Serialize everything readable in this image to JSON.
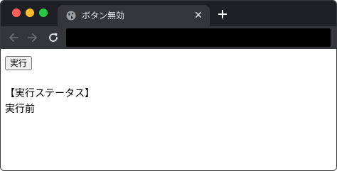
{
  "window": {
    "traffic_lights": [
      "close",
      "minimize",
      "maximize"
    ]
  },
  "tab": {
    "title": "ボタン無効",
    "favicon": "globe-icon",
    "close_glyph": "✕"
  },
  "toolbar": {
    "back_icon": "arrow-left-icon",
    "forward_icon": "arrow-right-icon",
    "reload_icon": "reload-icon",
    "address": ""
  },
  "page": {
    "run_button_label": "実行",
    "status_heading": "【実行ステータス】",
    "status_value": "実行前"
  },
  "colors": {
    "titlebar": "#1f2023",
    "tab": "#35363a",
    "toolbar": "#35363a",
    "omnibox": "#000000",
    "traffic_red": "#ff5f57",
    "traffic_yellow": "#febc2e",
    "traffic_green": "#28c840"
  }
}
